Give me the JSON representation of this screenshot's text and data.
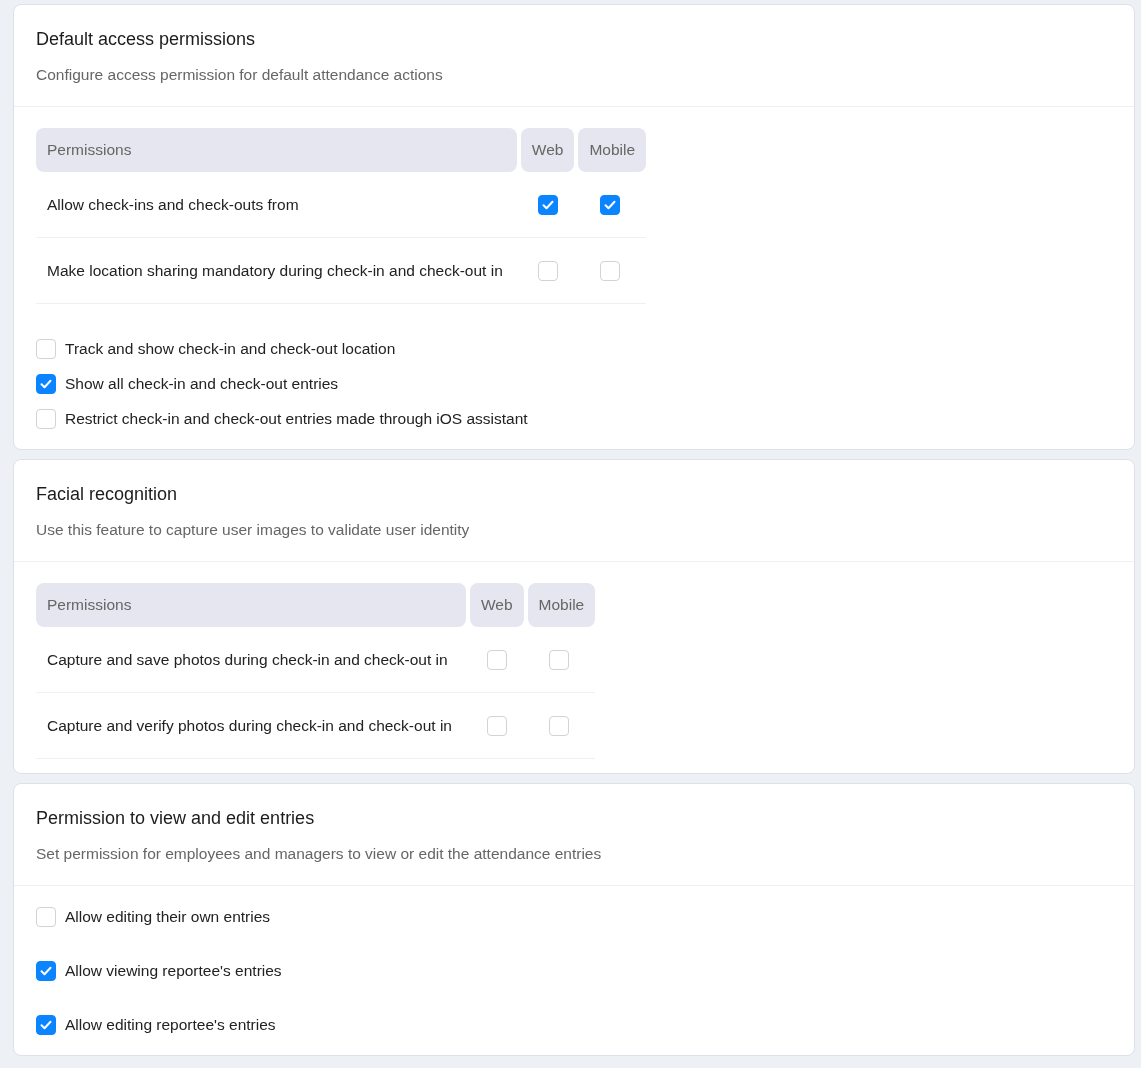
{
  "sections": [
    {
      "title": "Default access permissions",
      "subtitle": "Configure access permission for default attendance actions",
      "table": {
        "columns": [
          "Permissions",
          "Web",
          "Mobile"
        ],
        "rows": [
          {
            "label": "Allow check-ins and check-outs from",
            "web": true,
            "mobile": true
          },
          {
            "label": "Make location sharing mandatory during check-in and check-out in",
            "web": false,
            "mobile": false
          }
        ]
      },
      "options": [
        {
          "label": "Track and show check-in and check-out location",
          "checked": false
        },
        {
          "label": "Show all check-in and check-out entries",
          "checked": true
        },
        {
          "label": "Restrict check-in and check-out entries made through iOS assistant",
          "checked": false
        }
      ]
    },
    {
      "title": "Facial recognition",
      "subtitle": "Use this feature to capture user images to validate user identity",
      "table": {
        "columns": [
          "Permissions",
          "Web",
          "Mobile"
        ],
        "rows": [
          {
            "label": "Capture and save photos during check-in and check-out in",
            "web": false,
            "mobile": false
          },
          {
            "label": "Capture and verify photos during check-in and check-out in",
            "web": false,
            "mobile": false
          }
        ]
      }
    },
    {
      "title": "Permission to view and edit entries",
      "subtitle": "Set permission for employees and managers to view or edit the attendance entries",
      "options": [
        {
          "label": "Allow editing their own entries",
          "checked": false
        },
        {
          "label": "Allow viewing reportee's entries",
          "checked": true
        },
        {
          "label": "Allow editing reportee's entries",
          "checked": true
        }
      ]
    }
  ]
}
